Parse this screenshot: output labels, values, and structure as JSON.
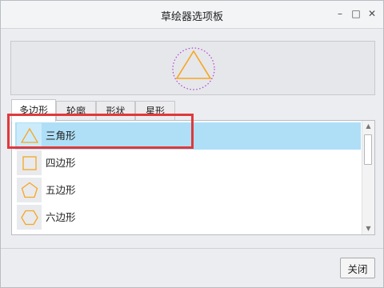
{
  "window": {
    "title": "草绘器选项板"
  },
  "window_controls": {
    "minimize": "–",
    "maximize": "□",
    "close": "✕"
  },
  "preview": {
    "shape_icon": "triangle-in-dotted-circle",
    "accent_color": "#f5a623",
    "circle_color": "#b040d8"
  },
  "tabs": [
    {
      "label": "多边形",
      "active": true
    },
    {
      "label": "轮廓",
      "active": false
    },
    {
      "label": "形状",
      "active": false
    },
    {
      "label": "星形",
      "active": false
    }
  ],
  "list": {
    "items": [
      {
        "label": "三角形",
        "icon": "triangle-icon",
        "selected": true
      },
      {
        "label": "四边形",
        "icon": "square-icon",
        "selected": false
      },
      {
        "label": "五边形",
        "icon": "pentagon-icon",
        "selected": false
      },
      {
        "label": "六边形",
        "icon": "hexagon-icon",
        "selected": false
      }
    ],
    "selection_color": "#aedff7",
    "highlight_color": "#e0393b"
  },
  "scrollbar": {
    "up_arrow": "▲",
    "down_arrow": "▼"
  },
  "footer": {
    "close_label": "关闭"
  }
}
